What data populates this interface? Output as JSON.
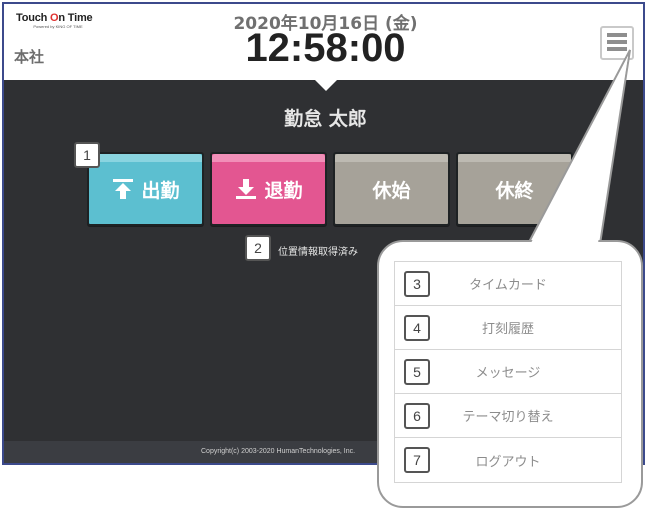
{
  "header": {
    "logo_part1": "Touch ",
    "logo_part2": "O",
    "logo_part3": "n Time",
    "logo_sub": "Powered by KING OF TIME",
    "branch": "本社",
    "date": "2020年10月16日 (金)",
    "time": "12:58:00"
  },
  "user": {
    "name": "勤怠 太郎"
  },
  "buttons": {
    "clock_in": "出勤",
    "clock_out": "退勤",
    "break_start": "休始",
    "break_end": "休終"
  },
  "location_status": "位置情報取得済み",
  "footer": {
    "copyright": "Copyright(c) 2003-2020 HumanTechnologies, Inc."
  },
  "badges": [
    "1",
    "2",
    "3",
    "4",
    "5",
    "6",
    "7"
  ],
  "menu": {
    "items": [
      {
        "number": "3",
        "label": "タイムカード"
      },
      {
        "number": "4",
        "label": "打刻履歴"
      },
      {
        "number": "5",
        "label": "メッセージ"
      },
      {
        "number": "6",
        "label": "テーマ切り替え"
      },
      {
        "number": "7",
        "label": "ログアウト"
      }
    ]
  },
  "colors": {
    "clock_in": "#5cbfd0",
    "clock_out": "#e35691",
    "break": "#a6a299",
    "background": "#2f3033",
    "logo_accent": "#e0312f"
  }
}
